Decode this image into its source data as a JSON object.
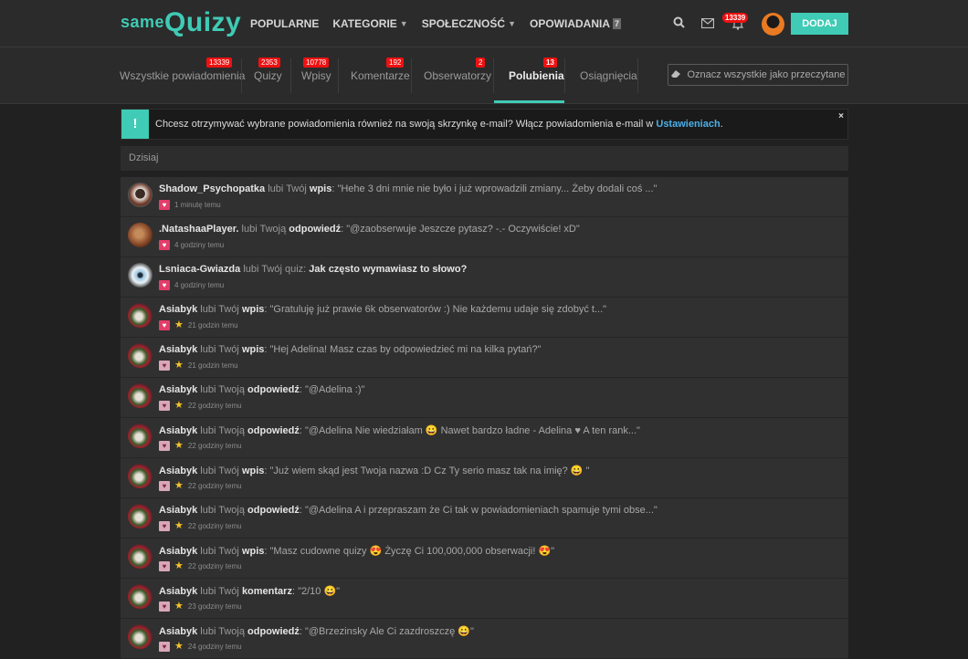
{
  "logo": {
    "small": "same",
    "big": "Quizy"
  },
  "nav": [
    {
      "label": "POPULARNE",
      "caret": false
    },
    {
      "label": "KATEGORIE",
      "caret": true
    },
    {
      "label": "SPOŁECZNOŚĆ",
      "caret": true
    },
    {
      "label": "OPOWIADANIA",
      "caret": false,
      "count": "7"
    }
  ],
  "top": {
    "notifications_count": "13339",
    "add_label": "DODAJ"
  },
  "tabs": [
    {
      "label": "Wszystkie powiadomienia",
      "badge": "13339"
    },
    {
      "label": "Quizy",
      "badge": "2353"
    },
    {
      "label": "Wpisy",
      "badge": "10778"
    },
    {
      "label": "Komentarze",
      "badge": "192"
    },
    {
      "label": "Obserwatorzy",
      "badge": "2"
    },
    {
      "label": "Polubienia",
      "badge": "13",
      "active": true
    },
    {
      "label": "Osiągnięcia",
      "badge": ""
    }
  ],
  "mark_all_read": "Oznacz wszystkie jako przeczytane",
  "info": {
    "text": "Chcesz otrzymywać wybrane powiadomienia również na swoją skrzynkę e-mail? Włącz powiadomienia e-mail w ",
    "link": "Ustawieniach",
    "after": ".",
    "close": "×"
  },
  "day_header": "Dzisiaj",
  "notifications": [
    {
      "user": "Shadow_Psychopatka",
      "verb": "lubi Twój",
      "object": "wpis",
      "quote": ": \"Hehe 3 dni mnie nie było i już wprowadzili zmiany... Żeby dodali coś ...\"",
      "time": "1 minutę temu"
    },
    {
      "user": ".NatashaaPlayer.",
      "verb": "lubi Twoją",
      "object": "odpowiedź",
      "quote": ": \"@zaobserwuje Jeszcze pytasz? -.- Oczywiście! xD\"",
      "time": "4 godziny temu"
    },
    {
      "user": "Lsniaca-Gwiazda",
      "verb": "lubi Twój quiz:",
      "object": "Jak często wymawiasz to słowo?",
      "quote": "",
      "time": "4 godziny temu"
    },
    {
      "user": "Asiabyk",
      "verb": "lubi Twój",
      "object": "wpis",
      "quote": ": \"Gratuluję już prawie 6k obserwatorów :) Nie każdemu udaje się zdobyć t...\"",
      "time": "21 godzin temu"
    },
    {
      "user": "Asiabyk",
      "verb": "lubi Twój",
      "object": "wpis",
      "quote": ": \"Hej Adelina! Masz czas by odpowiedzieć mi na kilka pytań?\"",
      "time": "21 godzin temu"
    },
    {
      "user": "Asiabyk",
      "verb": "lubi Twoją",
      "object": "odpowiedź",
      "quote": ": \"@Adelina :)\"",
      "time": "22 godziny temu"
    },
    {
      "user": "Asiabyk",
      "verb": "lubi Twoją",
      "object": "odpowiedź",
      "quote": ": \"@Adelina Nie wiedziałam 😀 Nawet bardzo ładne - Adelina ♥ A ten rank...\"",
      "time": "22 godziny temu"
    },
    {
      "user": "Asiabyk",
      "verb": "lubi Twój",
      "object": "wpis",
      "quote": ": \"Już wiem skąd jest Twoja nazwa :D Cz Ty serio masz tak na imię? 😀 \"",
      "time": "22 godziny temu"
    },
    {
      "user": "Asiabyk",
      "verb": "lubi Twoją",
      "object": "odpowiedź",
      "quote": ": \"@Adelina A i przepraszam że Ci tak w powiadomieniach spamuje tymi obse...\"",
      "time": "22 godziny temu"
    },
    {
      "user": "Asiabyk",
      "verb": "lubi Twój",
      "object": "wpis",
      "quote": ": \"Masz cudowne quizy 😍 Życzę Ci 100,000,000 obserwacji! 😍\"",
      "time": "22 godziny temu"
    },
    {
      "user": "Asiabyk",
      "verb": "lubi Twój",
      "object": "komentarz",
      "quote": ": \"2/10 😀\"",
      "time": "23 godziny temu"
    },
    {
      "user": "Asiabyk",
      "verb": "lubi Twoją",
      "object": "odpowiedź",
      "quote": ": \"@Brzezinsky Ale Ci zazdroszczę 😀\"",
      "time": "24 godziny temu"
    }
  ]
}
